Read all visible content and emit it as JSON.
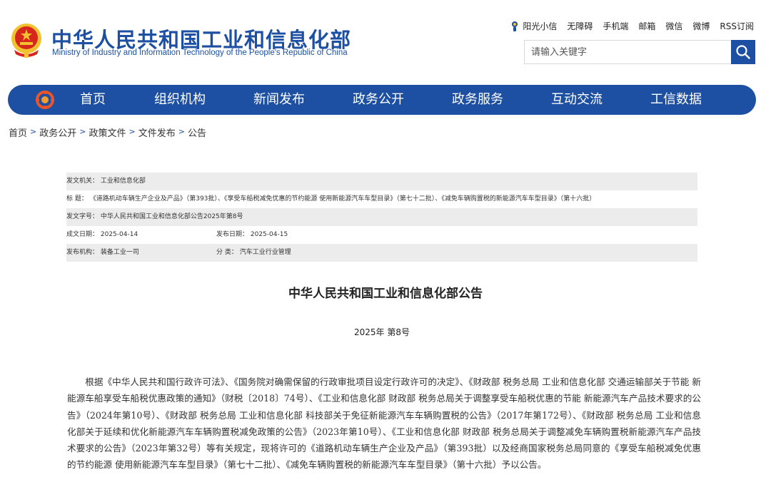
{
  "header": {
    "title_cn": "中华人民共和国工业和信息化部",
    "title_en": "Ministry of Industry and Information Technology of the People's Republic of China",
    "emblem_icon": "national-emblem-icon"
  },
  "toplinks": [
    "阳光小信",
    "无障碍",
    "手机端",
    "邮箱",
    "微信",
    "微博",
    "RSS订阅"
  ],
  "search": {
    "placeholder": "请输入关键字",
    "icon": "search-icon"
  },
  "nav": {
    "logo_icon": "ministry-logo-icon",
    "items": [
      "首页",
      "组织机构",
      "新闻发布",
      "政务公开",
      "政务服务",
      "互动交流",
      "工信数据"
    ]
  },
  "breadcrumb": [
    "首页",
    "政务公开",
    "政策文件",
    "文件发布",
    "公告"
  ],
  "info": {
    "issuer": "发文机关：  工业和信息化部",
    "title": "标      题：  《道路机动车辆生产企业及产品》（第393批）、《享受车船税减免优惠的节约能源 使用新能源汽车车型目录》（第七十二批）、《减免车辆购置税的新能源汽车车型目录》（第十六批）",
    "doc_number": "发文字号：  中华人民共和国工业和信息化部公告2025年第8号",
    "created": "成文日期：  2025-04-14",
    "published": "发布日期：  2025-04-15",
    "publisher": "发布机构：  装备工业一司",
    "category": "分      类：  汽车工业行业管理"
  },
  "document": {
    "title": "中华人民共和国工业和信息化部公告",
    "number": "2025年   第8号",
    "body": "根据《中华人民共和国行政许可法》、《国务院对确需保留的行政审批项目设定行政许可的决定》、《财政部 税务总局 工业和信息化部 交通运输部关于节能 新能源车船享受车船税优惠政策的通知》（财税〔2018〕74号）、《工业和信息化部 财政部 税务总局关于调整享受车船税优惠的节能 新能源汽车产品技术要求的公告》（2024年第10号）、《财政部 税务总局 工业和信息化部 科技部关于免征新能源汽车车辆购置税的公告》（2017年第172号）、《财政部 税务总局 工业和信息化部关于延续和优化新能源汽车车辆购置税减免政策的公告》（2023年第10号）、《工业和信息化部 财政部 税务总局关于调整减免车辆购置税新能源汽车产品技术要求的公告》（2023年第32号）等有关规定，现将许可的《道路机动车辆生产企业及产品》（第393批）以及经商国家税务总局同意的《享受车船税减免优惠的节约能源 使用新能源汽车车型目录》（第七十二批）、《减免车辆购置税的新能源汽车车型目录》（第十六批）予以公告。"
  },
  "colors": {
    "brand_blue": "#1d50a2",
    "row_shade": "#ececec",
    "emblem_red": "#d7261e",
    "emblem_gold": "#f2c22e"
  }
}
